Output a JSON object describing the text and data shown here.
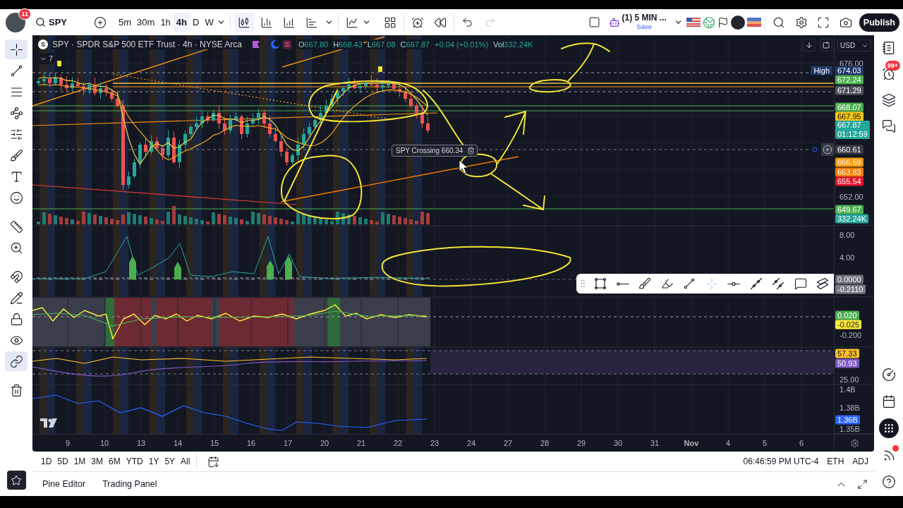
{
  "top_bar": {
    "notifications": "11",
    "symbol": "SPY",
    "intervals": [
      {
        "label": "5m",
        "selected": false
      },
      {
        "label": "30m",
        "selected": false
      },
      {
        "label": "1h",
        "selected": false
      },
      {
        "label": "4h",
        "selected": true
      },
      {
        "label": "D",
        "selected": false
      },
      {
        "label": "W",
        "selected": false
      }
    ],
    "chart_style_selected": true,
    "redo_disabled": true,
    "layout": {
      "name": "(1) 5 MIN ...",
      "action": "Save"
    },
    "publish": "Publish"
  },
  "left_toolbar": {
    "tool_groups": [
      [
        {
          "kind": "crosshair",
          "selected": true
        },
        {
          "kind": "trend_line",
          "selected": false
        },
        {
          "kind": "fibonacci",
          "selected": false
        },
        {
          "kind": "patterns",
          "selected": false
        },
        {
          "kind": "forecast",
          "selected": false
        },
        {
          "kind": "brush",
          "selected": false
        },
        {
          "kind": "text",
          "selected": false
        },
        {
          "kind": "emoji",
          "selected": false
        }
      ],
      [
        {
          "kind": "ruler",
          "selected": false
        },
        {
          "kind": "zoom",
          "selected": false
        }
      ],
      [
        {
          "kind": "magnet",
          "selected": false
        },
        {
          "kind": "drawing_lock",
          "selected": false
        },
        {
          "kind": "lock",
          "selected": false
        },
        {
          "kind": "visibility",
          "selected": false
        },
        {
          "kind": "sync",
          "selected": true
        }
      ],
      [
        {
          "kind": "remove",
          "selected": false
        }
      ]
    ]
  },
  "chart": {
    "legend": {
      "badge": "S",
      "title": "SPY · SPDR S&P 500 ETF Trust · 4h · NYSE Arca",
      "ohlc": [
        {
          "key": "O",
          "value": "667.80"
        },
        {
          "key": "H",
          "value": "668.43"
        },
        {
          "key": "L",
          "value": "667.08"
        },
        {
          "key": "C",
          "value": "667.87"
        }
      ],
      "change": "+0.04 (+0.01%)",
      "volume": {
        "key": "Vol",
        "value": "332.24K"
      },
      "hidden_count": "7"
    },
    "currency": "USD",
    "alert": {
      "label": "SPY Crossing 660.34"
    },
    "panes": [
      {
        "axis": [
          {
            "kind": "tick",
            "text": "676.00"
          },
          {
            "kind": "tag",
            "text": "674.03",
            "color": "#1f3566",
            "note": "High"
          },
          {
            "kind": "tag",
            "text": "672.24",
            "color": "#4caf50"
          },
          {
            "kind": "tag",
            "text": "671.29",
            "color": "#50535e"
          },
          {
            "kind": "tag",
            "text": "668.07",
            "color": "#4caf50"
          },
          {
            "kind": "tag",
            "text": "667.95",
            "color": "#f5c518"
          },
          {
            "kind": "tag",
            "text": "667.87",
            "color": "#26a69a",
            "timer": "01:12:59"
          },
          {
            "kind": "tag",
            "text": "660.61",
            "color": "#363a45"
          },
          {
            "kind": "tag",
            "text": "666.59",
            "color": "#ff9800"
          },
          {
            "kind": "tag",
            "text": "663.83",
            "color": "#f57c00"
          },
          {
            "kind": "tag",
            "text": "655.54",
            "color": "#e5132b"
          },
          {
            "kind": "tick",
            "text": "652.00"
          },
          {
            "kind": "tag",
            "text": "649.67",
            "color": "#4caf50"
          },
          {
            "kind": "tag",
            "text": "332.24K",
            "color": "#26a69a"
          }
        ]
      },
      {
        "axis": [
          {
            "kind": "tick",
            "text": "8.00"
          },
          {
            "kind": "tick",
            "text": "4.00"
          },
          {
            "kind": "tag",
            "text": "0.0000",
            "color": "#6a6d78"
          },
          {
            "kind": "tag",
            "text": "-0.2110",
            "color": "#787b86"
          }
        ]
      },
      {
        "axis": [
          {
            "kind": "tag",
            "text": "0.020",
            "color": "#4caf50"
          },
          {
            "kind": "tag",
            "text": "-0.025",
            "color": "#ffeb3b"
          },
          {
            "kind": "tick",
            "text": "-0.200"
          }
        ]
      },
      {
        "axis": [
          {
            "kind": "tag",
            "text": "57.33",
            "color": "#fbc02d"
          },
          {
            "kind": "tag",
            "text": "50.93",
            "color": "#7e57c2"
          },
          {
            "kind": "tick",
            "text": "25.00"
          }
        ]
      },
      {
        "axis": [
          {
            "kind": "tick",
            "text": "1.4B"
          },
          {
            "kind": "tick",
            "text": "1.38B"
          },
          {
            "kind": "tag",
            "text": "1.36B",
            "color": "#2962ff"
          },
          {
            "kind": "tick",
            "text": "1.35B"
          }
        ]
      }
    ],
    "time_axis": [
      {
        "label": "9",
        "kind": "day"
      },
      {
        "label": "10",
        "kind": "day"
      },
      {
        "label": "13",
        "kind": "day"
      },
      {
        "label": "14",
        "kind": "day"
      },
      {
        "label": "15",
        "kind": "day"
      },
      {
        "label": "16",
        "kind": "day"
      },
      {
        "label": "17",
        "kind": "day"
      },
      {
        "label": "20",
        "kind": "day"
      },
      {
        "label": "21",
        "kind": "day"
      },
      {
        "label": "22",
        "kind": "day"
      },
      {
        "label": "23",
        "kind": "day"
      },
      {
        "label": "24",
        "kind": "day"
      },
      {
        "label": "27",
        "kind": "day"
      },
      {
        "label": "28",
        "kind": "day"
      },
      {
        "label": "29",
        "kind": "day"
      },
      {
        "label": "30",
        "kind": "day"
      },
      {
        "label": "31",
        "kind": "day"
      },
      {
        "label": "Nov",
        "kind": "month"
      },
      {
        "label": "4",
        "kind": "day"
      },
      {
        "label": "5",
        "kind": "day"
      },
      {
        "label": "6",
        "kind": "day"
      }
    ]
  },
  "range_bar": {
    "ranges": [
      "1D",
      "5D",
      "1M",
      "3M",
      "6M",
      "YTD",
      "1Y",
      "5Y",
      "All"
    ],
    "clock": "06:46:59 PM UTC-4",
    "session": "ETH",
    "adjustment": "ADJ"
  },
  "bottom_tabs": [
    "Pine Editor",
    "Trading Panel"
  ],
  "right_sidebar": {
    "alerts_badge": "99+",
    "feed_dot": true
  }
}
